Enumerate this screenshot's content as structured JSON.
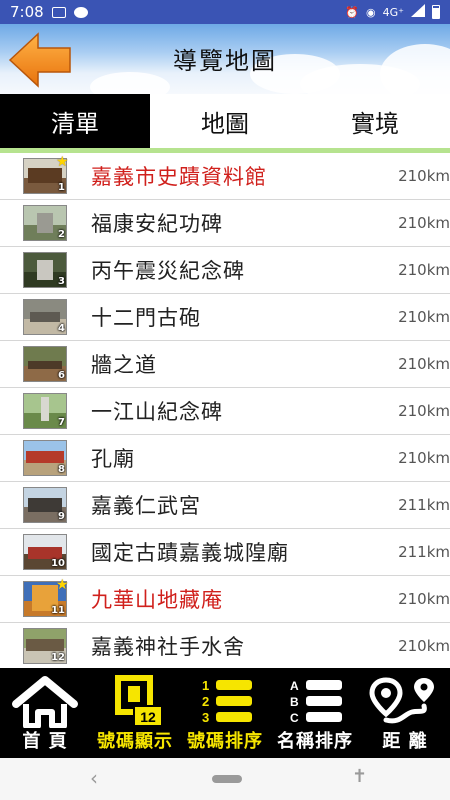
{
  "status_bar": {
    "time": "7:08",
    "network": "4G⁺",
    "icons": [
      "image-icon",
      "message-icon",
      "alarm-icon",
      "location-icon",
      "signal-icon",
      "battery-icon"
    ]
  },
  "header": {
    "title": "導覽地圖",
    "back_icon": "orange-left-arrow-icon"
  },
  "tabs": [
    {
      "label": "清單",
      "active": true
    },
    {
      "label": "地圖",
      "active": false
    },
    {
      "label": "實境",
      "active": false
    }
  ],
  "list": [
    {
      "num": "1",
      "name": "嘉義市史蹟資料館",
      "distance": "210km",
      "starred": true,
      "highlight": true
    },
    {
      "num": "2",
      "name": "福康安紀功碑",
      "distance": "210km",
      "starred": false,
      "highlight": false
    },
    {
      "num": "3",
      "name": "丙午震災紀念碑",
      "distance": "210km",
      "starred": false,
      "highlight": false
    },
    {
      "num": "4",
      "name": "十二門古砲",
      "distance": "210km",
      "starred": false,
      "highlight": false
    },
    {
      "num": "6",
      "name": "牆之道",
      "distance": "210km",
      "starred": false,
      "highlight": false
    },
    {
      "num": "7",
      "name": "一江山紀念碑",
      "distance": "210km",
      "starred": false,
      "highlight": false
    },
    {
      "num": "8",
      "name": "孔廟",
      "distance": "210km",
      "starred": false,
      "highlight": false
    },
    {
      "num": "9",
      "name": "嘉義仁武宮",
      "distance": "211km",
      "starred": false,
      "highlight": false
    },
    {
      "num": "10",
      "name": "國定古蹟嘉義城隍廟",
      "distance": "211km",
      "starred": false,
      "highlight": false
    },
    {
      "num": "11",
      "name": "九華山地藏庵",
      "distance": "210km",
      "starred": true,
      "highlight": true
    },
    {
      "num": "12",
      "name": "嘉義神社手水舍",
      "distance": "210km",
      "starred": false,
      "highlight": false
    }
  ],
  "bottom_nav": [
    {
      "label": "首 頁",
      "icon": "home-icon",
      "active": false
    },
    {
      "label": "號碼顯示",
      "icon": "number-display-icon",
      "active": true,
      "icon_text": "12"
    },
    {
      "label": "號碼排序",
      "icon": "number-sort-icon",
      "active": true,
      "icon_text": [
        "1",
        "2",
        "3"
      ]
    },
    {
      "label": "名稱排序",
      "icon": "name-sort-icon",
      "active": false,
      "icon_text": [
        "A",
        "B",
        "C"
      ]
    },
    {
      "label": "距 離",
      "icon": "distance-route-icon",
      "active": false
    }
  ],
  "colors": {
    "status_bar": "#3a54b4",
    "highlight_text": "#d0201c",
    "nav_active": "#f6e500",
    "tab_underline": "#b6e38f",
    "back_arrow": "#f28a1c"
  }
}
